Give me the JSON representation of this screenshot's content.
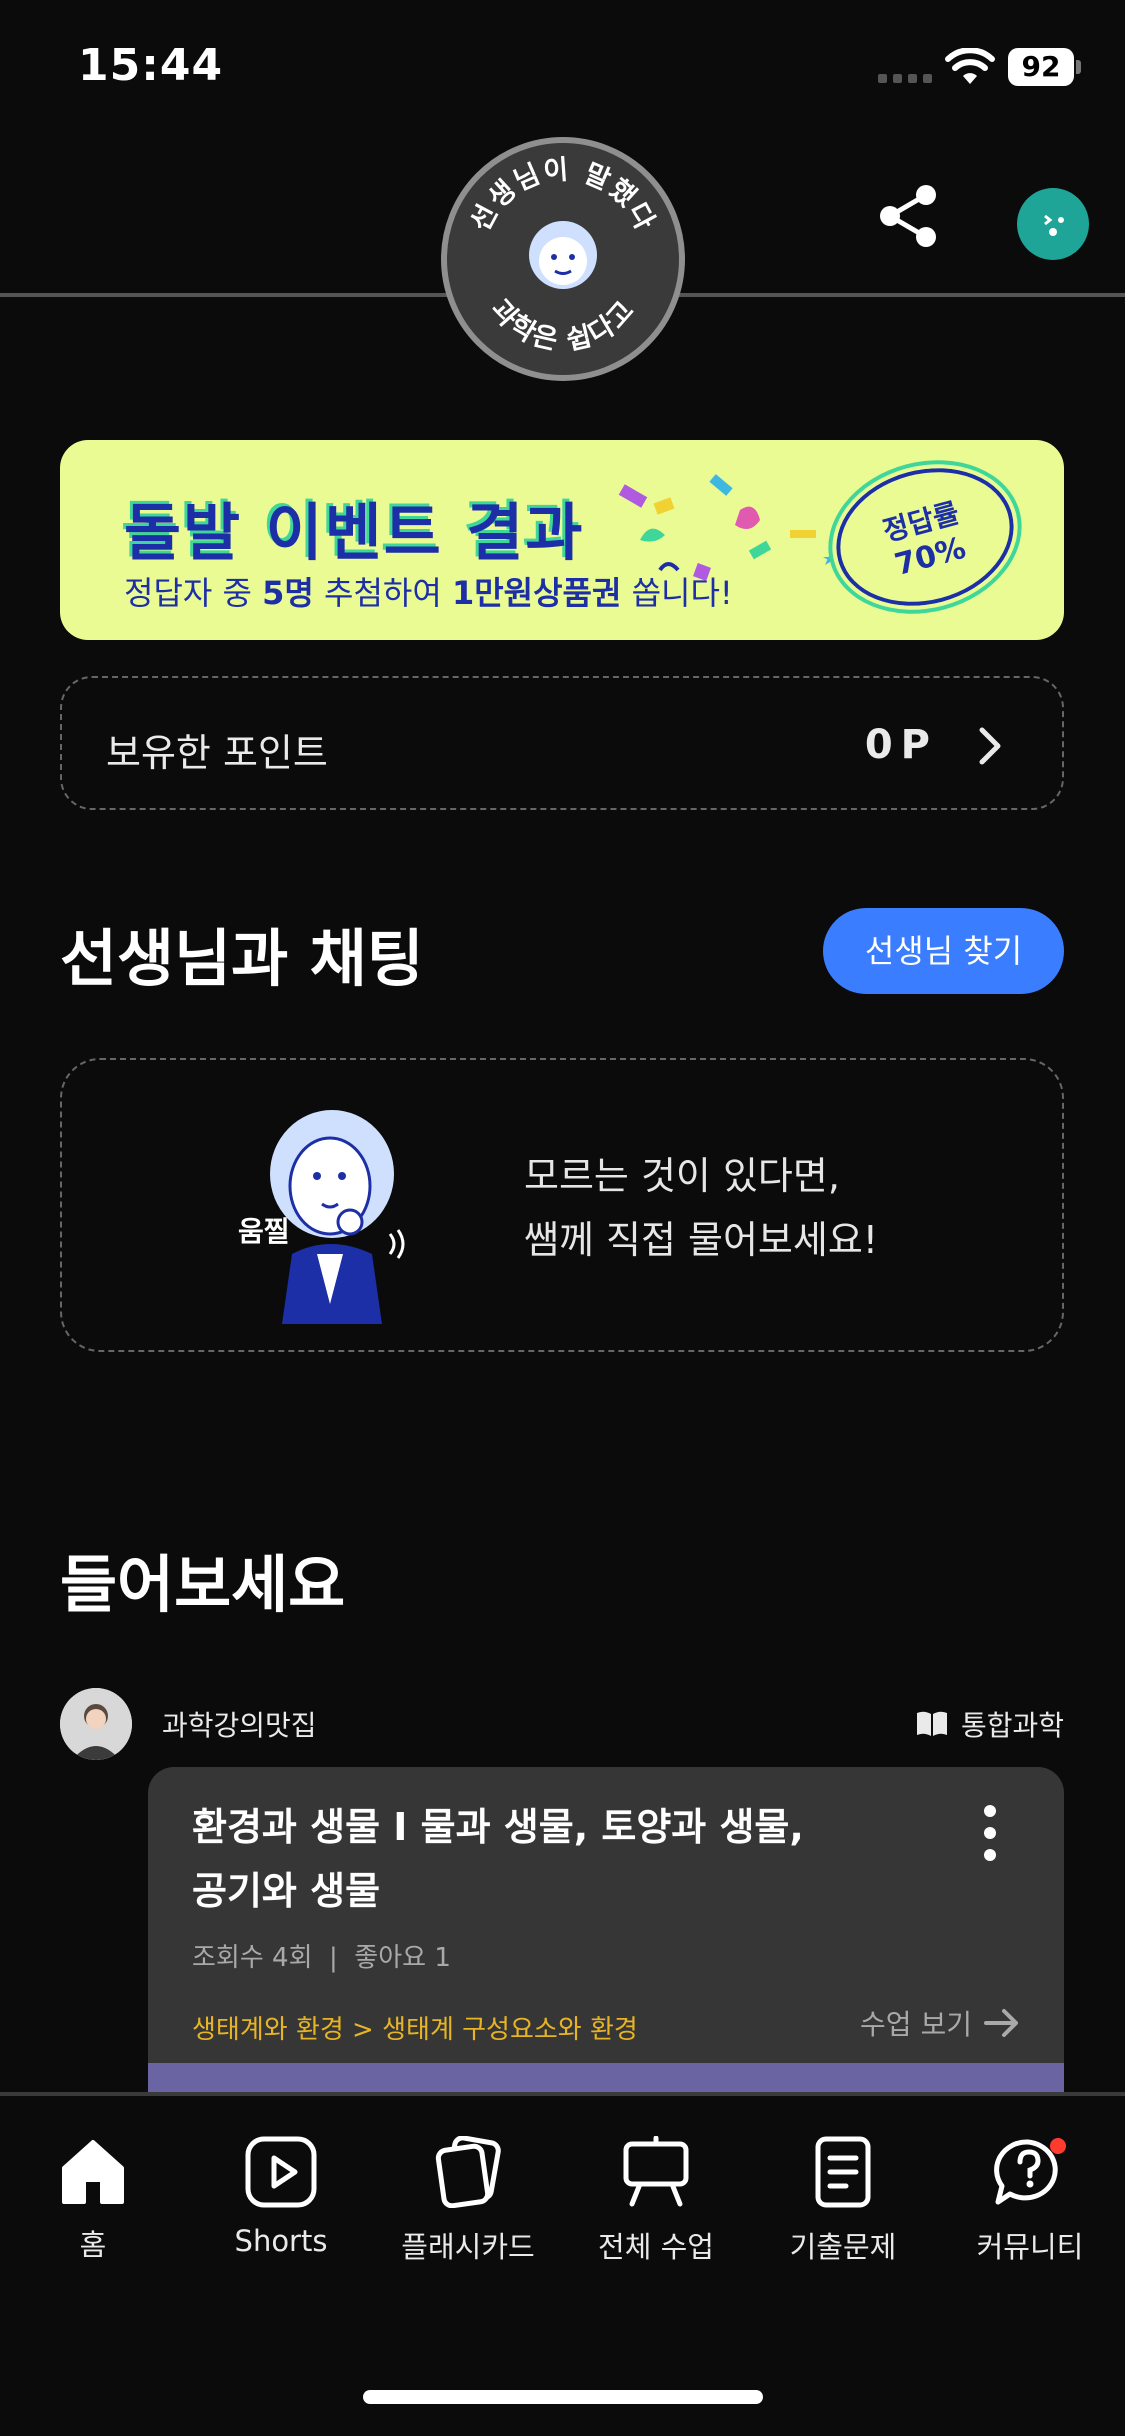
{
  "status_bar": {
    "time": "15:44",
    "battery": "92"
  },
  "header": {
    "logo_text_top": "선생님이 말했다",
    "logo_text_bottom": "과학은 쉽다고",
    "share_icon": "share-icon",
    "profile_icon": "profile-icon"
  },
  "banner": {
    "title": "돌발 이벤트 결과",
    "sub_pre": "정답자 중 ",
    "sub_count": "5명",
    "sub_mid": " 추첨하여 ",
    "sub_prize": "1만원상품권",
    "sub_post": " 쏩니다!",
    "badge_line1": "정답률",
    "badge_line2": "70%"
  },
  "points": {
    "label": "보유한 포인트",
    "value": "0P"
  },
  "chat_section": {
    "title": "선생님과 채팅",
    "find_button": "선생님 찾기",
    "illus_label": "움찔",
    "line1": "모르는 것이 있다면,",
    "line2": "쌤께 직접 물어보세요!"
  },
  "listen_section": {
    "title": "들어보세요",
    "channel_name": "과학강의맛집",
    "subject": "통합과학",
    "video": {
      "title_line1": "환경과 생물 I 물과 생물, 토양과 생물,",
      "title_line2": "공기와 생물",
      "meta": "조회수 4회  |  좋아요 1",
      "path": "생태계와 환경 > 생태계 구성요소와 환경",
      "watch_label": "수업 보기"
    }
  },
  "bottom_nav": {
    "items": [
      {
        "label": "홈",
        "icon": "home-icon"
      },
      {
        "label": "Shorts",
        "icon": "play-icon"
      },
      {
        "label": "플래시카드",
        "icon": "flashcards-icon"
      },
      {
        "label": "전체 수업",
        "icon": "easel-icon"
      },
      {
        "label": "기출문제",
        "icon": "document-icon"
      },
      {
        "label": "커뮤니티",
        "icon": "question-bubble-icon"
      }
    ]
  },
  "colors": {
    "background": "#0b0b0b",
    "accent_blue": "#3a7dff",
    "banner_bg": "#eafb94",
    "banner_text": "#1d2fa6",
    "path_yellow": "#e7b425",
    "profile_teal": "#1fa597",
    "notification_red": "#ff3b30"
  }
}
